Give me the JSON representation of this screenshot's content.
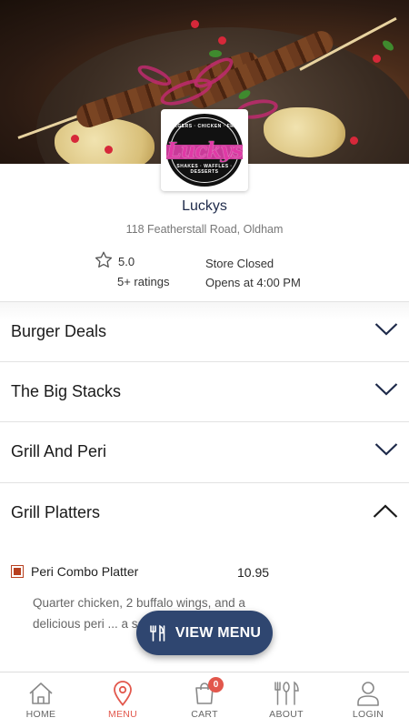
{
  "store": {
    "name": "Luckys",
    "address": "118 Featherstall Road, Oldham",
    "rating": "5.0",
    "rating_count": "5+ ratings",
    "status": "Store Closed",
    "opens": "Opens at 4:00 PM",
    "logo": {
      "word": "Luckys",
      "top_text": "BURGERS · CHICKEN · FRIES",
      "bottom_text": "SHAKES · WAFFLES · DESSERTS"
    }
  },
  "categories": [
    {
      "label": "Burger Deals",
      "expanded": false
    },
    {
      "label": "The Big Stacks",
      "expanded": false
    },
    {
      "label": "Grill And Peri",
      "expanded": false
    },
    {
      "label": "Grill Platters",
      "expanded": true
    }
  ],
  "items": [
    {
      "name": "Peri Combo Platter",
      "price": "10.95",
      "description": "Quarter chicken, 2 buffalo wings, and a delicious peri ... a same board"
    }
  ],
  "view_menu": {
    "label": "VIEW MENU",
    "icon": "cutlery-icon"
  },
  "nav": {
    "items": [
      {
        "label": "HOME",
        "icon": "home-icon",
        "active": false
      },
      {
        "label": "MENU",
        "icon": "map-pin-icon",
        "active": true
      },
      {
        "label": "CART",
        "icon": "shopping-bag-icon",
        "active": false,
        "badge": "0"
      },
      {
        "label": "ABOUT",
        "icon": "cutlery-icon",
        "active": false
      },
      {
        "label": "LOGIN",
        "icon": "user-icon",
        "active": false
      }
    ]
  },
  "colors": {
    "accent": "#e2574c",
    "button": "#2f4670",
    "title": "#1e2a4a",
    "checkbox": "#b8401f"
  }
}
